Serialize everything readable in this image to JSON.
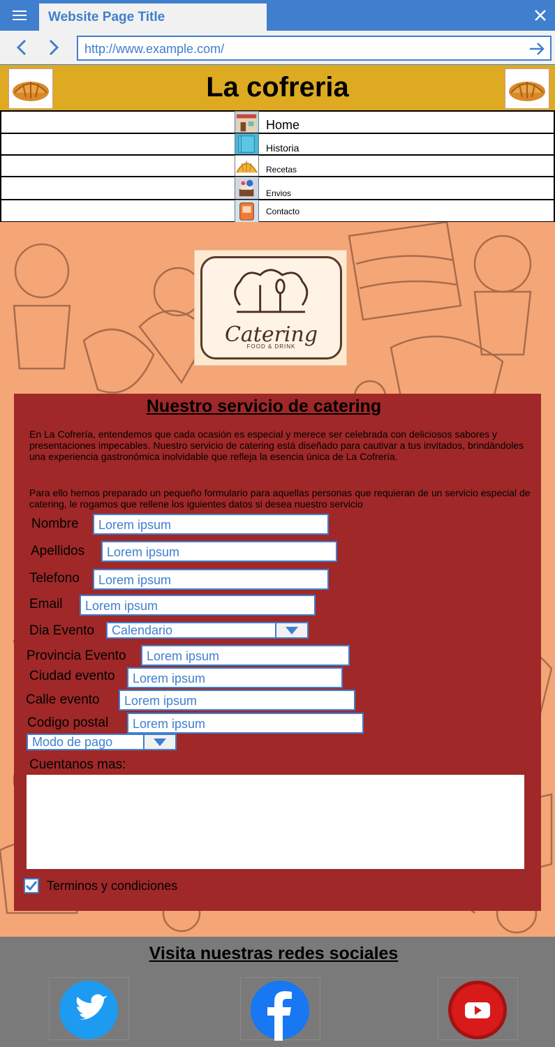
{
  "browser": {
    "tab_title": "Website Page Title",
    "url": "http://www.example.com/"
  },
  "site": {
    "title": "La cofreria"
  },
  "menu": {
    "items": [
      {
        "label": "Home",
        "icon": "shop-icon"
      },
      {
        "label": "Historia",
        "icon": "book-icon"
      },
      {
        "label": "Recetas",
        "icon": "croissant-icon"
      },
      {
        "label": "Envios",
        "icon": "delivery-icon"
      },
      {
        "label": "Contacto",
        "icon": "phone-icon"
      }
    ]
  },
  "hero": {
    "logo_text": "Catering",
    "logo_sub": "FOOD & DRINK"
  },
  "panel": {
    "title": "Nuestro servicio de catering",
    "intro": "En La Cofrería, entendemos que cada ocasión es especial y merece ser celebrada con deliciosos sabores y presentaciones impecables. Nuestro servicio de catering está diseñado para cautivar a tus invitados, brindándoles una experiencia gastronómica inolvidable que refleja la esencia única de La Cofrería.",
    "form_intro": "Para ello hemos preparado un pequeño formulario para aquellas personas que requieran de un servicio especial de catering, le rogamos que rellene los iguientes datos si desea nuestro servicio"
  },
  "form": {
    "nombre": {
      "label": "Nombre",
      "value": "Lorem ipsum"
    },
    "apellidos": {
      "label": "Apellidos",
      "value": "Lorem ipsum"
    },
    "telefono": {
      "label": "Telefono",
      "value": "Lorem ipsum"
    },
    "email": {
      "label": "Email",
      "value": "Lorem ipsum"
    },
    "dia_evento": {
      "label": "Dia Evento",
      "value": "Calendario"
    },
    "provincia": {
      "label": "Provincia Evento",
      "value": "Lorem ipsum"
    },
    "ciudad": {
      "label": "Ciudad evento",
      "value": "Lorem ipsum"
    },
    "calle": {
      "label": "Calle evento",
      "value": "Lorem ipsum"
    },
    "codigo_postal": {
      "label": "Codigo postal",
      "value": "Lorem ipsum"
    },
    "modo_pago": {
      "value": "Modo de pago"
    },
    "mas": {
      "label": "Cuentanos mas:"
    },
    "terminos": {
      "label": "Terminos y condiciones",
      "checked": true
    }
  },
  "footer": {
    "title": "Visita nuestras redes sociales",
    "socials": [
      {
        "name": "twitter-icon",
        "color": "#1d9bf0"
      },
      {
        "name": "facebook-icon",
        "color": "#1877f2"
      },
      {
        "name": "youtube-icon",
        "color": "#d81a1a"
      }
    ]
  },
  "colors": {
    "accent": "#3f7fcd",
    "header": "#ddaa22",
    "hero": "#f5a676",
    "panel": "#a02828",
    "footer": "#7a7a7a"
  }
}
